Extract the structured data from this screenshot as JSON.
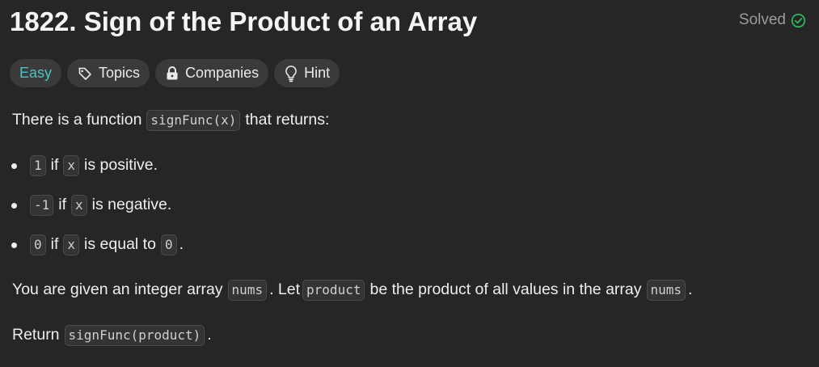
{
  "problem": {
    "title": "1822. Sign of the Product of an Array",
    "status": "Solved",
    "difficulty": "Easy",
    "tags": {
      "topics": "Topics",
      "companies": "Companies",
      "hint": "Hint"
    }
  },
  "description": {
    "intro_before": "There is a function",
    "intro_code": "signFunc(x)",
    "intro_after": "that returns:",
    "bullets": [
      {
        "value": "1",
        "if": "if",
        "var": "x",
        "text": "is positive.",
        "extra": ""
      },
      {
        "value": "-1",
        "if": "if",
        "var": "x",
        "text": "is negative.",
        "extra": ""
      },
      {
        "value": "0",
        "if": "if",
        "var": "x",
        "text": "is equal to",
        "extra": "0"
      }
    ],
    "given": {
      "p1": "You are given an integer array",
      "c1": "nums",
      "p2": ". Let",
      "c2": "product",
      "p3": "be the product of all values in the array",
      "c3": "nums",
      "p4": "."
    },
    "ret": {
      "p1": "Return",
      "c1": "signFunc(product)",
      "p2": "."
    }
  },
  "colors": {
    "background": "#262626",
    "easy": "#46c6c2",
    "solved_check": "#2cbb5d",
    "chip": "#3a3a3a"
  }
}
